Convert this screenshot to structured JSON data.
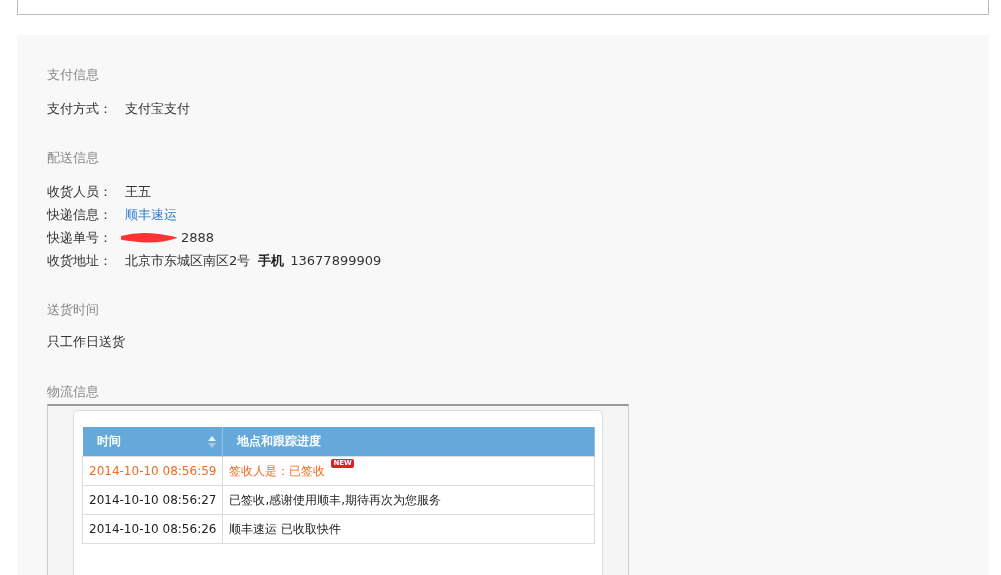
{
  "sections": [
    {
      "title": "支付信息",
      "kind": "fields",
      "fields": [
        {
          "label": "支付方式：",
          "value": "支付宝支付",
          "kind": "plain"
        }
      ]
    },
    {
      "title": "配送信息",
      "kind": "fields",
      "fields": [
        {
          "label": "收货人员：",
          "value": "王五",
          "kind": "plain"
        },
        {
          "label": "快递信息：",
          "value": "顺丰速运",
          "kind": "link"
        },
        {
          "label": "快递单号：",
          "value": "2888",
          "kind": "redacted"
        },
        {
          "label": "收货地址：",
          "value": "北京市东城区南区2号",
          "kind": "phone",
          "phone_label": "手机",
          "phone": "13677899909"
        }
      ]
    },
    {
      "title": "送货时间",
      "kind": "text",
      "text": "只工作日送货"
    },
    {
      "title": "物流信息",
      "kind": "tracking",
      "table": {
        "columns": [
          {
            "label": "时间",
            "sortable": true
          },
          {
            "label": "地点和跟踪进度",
            "sortable": false
          }
        ],
        "rows": [
          {
            "time": "2014-10-10 08:56:59",
            "status": "签收人是：已签收",
            "latest": true,
            "badge": "NEW"
          },
          {
            "time": "2014-10-10 08:56:27",
            "status": "已签收,感谢使用顺丰,期待再次为您服务",
            "latest": false
          },
          {
            "time": "2014-10-10 08:56:26",
            "status": "顺丰速运 已收取快件",
            "latest": false
          }
        ]
      }
    }
  ]
}
